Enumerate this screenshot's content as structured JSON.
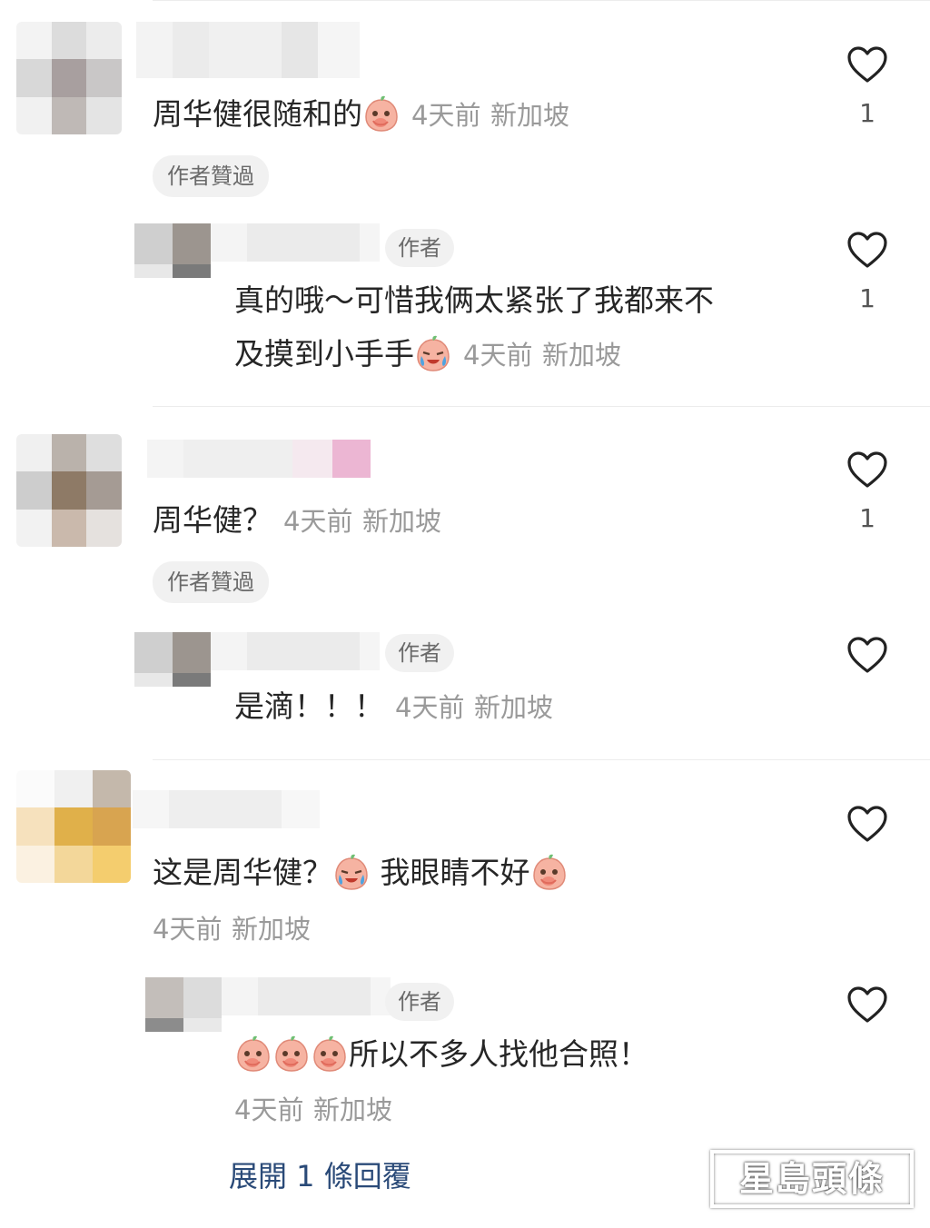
{
  "comments": [
    {
      "text": "周华健很随和的",
      "time": "4天前",
      "location": "新加坡",
      "liked_by_author": "作者贊過",
      "likes": "1",
      "reply": {
        "author_tag": "作者",
        "text_line1": "真的哦～可惜我俩太紧张了我都来不",
        "text_line2": "及摸到小手手",
        "time": "4天前",
        "location": "新加坡",
        "likes": "1"
      }
    },
    {
      "text": "周华健？",
      "time": "4天前",
      "location": "新加坡",
      "liked_by_author": "作者贊過",
      "likes": "1",
      "reply": {
        "author_tag": "作者",
        "text": "是滴！！！",
        "time": "4天前",
        "location": "新加坡"
      }
    },
    {
      "text_part1": "这是周华健？",
      "text_part2": "我眼睛不好",
      "time": "4天前",
      "location": "新加坡",
      "reply": {
        "author_tag": "作者",
        "text": "所以不多人找他合照！",
        "time": "4天前",
        "location": "新加坡"
      }
    }
  ],
  "expand_replies": "展開 1 條回覆",
  "watermark": "星島頭條",
  "icons": {
    "like": "heart-outline-icon",
    "emoji_cover_mouth": "peach-cover-mouth-emoji",
    "emoji_crying": "peach-crying-emoji"
  },
  "colors": {
    "text": "#262626",
    "meta": "#9a9a9a",
    "chip_bg": "#f1f1f1",
    "link": "#2a4a78"
  }
}
